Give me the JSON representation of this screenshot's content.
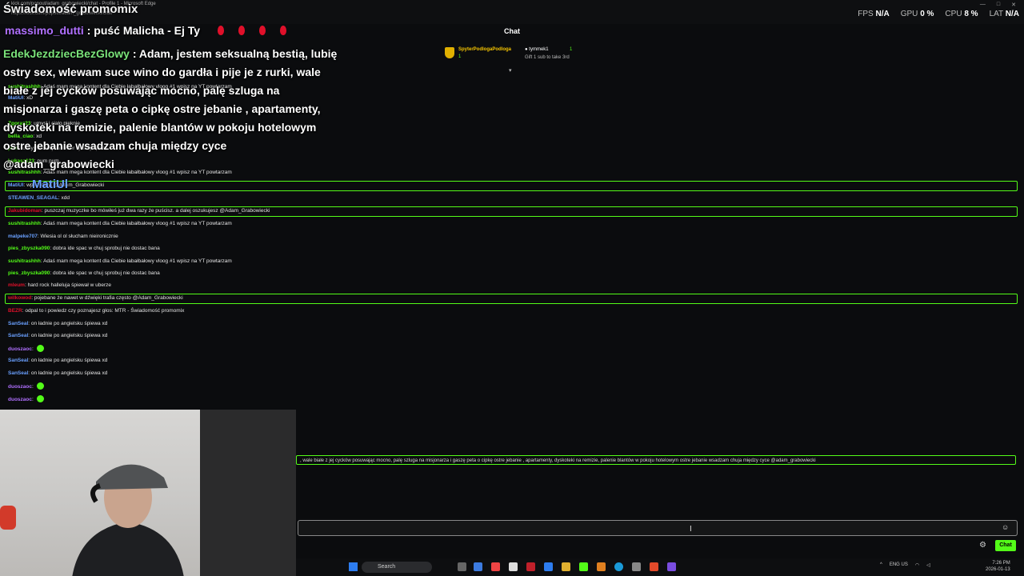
{
  "browser": {
    "title": "kick.com/popout/adam_grabowiecki/chat - Profile 1 - Microsoft Edge",
    "url": "https://kick.com/popout/adam_grabowiecki/chat",
    "controls": [
      "—",
      "□",
      "✕"
    ]
  },
  "stream_title": "Świadomość promomix",
  "perf": [
    {
      "label": "FPS",
      "value": "N/A"
    },
    {
      "label": "GPU",
      "value": "0 %"
    },
    {
      "label": "CPU",
      "value": "8 %"
    },
    {
      "label": "LAT",
      "value": "N/A"
    }
  ],
  "overlay_top": {
    "user": "massimo_dutti",
    "sep": " : ",
    "text": "puść Malicha - Ej Ty"
  },
  "chat_header": "Chat",
  "pinned": {
    "gifter": "SpyterPodlogaPodloga",
    "gifter_count": "1",
    "receiver": "tymmek1",
    "receiver_count": "1",
    "gift_text": "Gift 1 sub to take 3rd"
  },
  "big_message": {
    "user": "EdekJezdziecBezGlowy",
    "sep": " : ",
    "text": "Adam, jestem seksualną bestią, lubię ostry sex, wlewam suce wino do gardła i pije je z rurki, wale białe z jej cycków posuwając mocno, palę szluga na misjonarza i gaszę peta o cipkę ostre jebanie , apartamenty, dyskoteki na remizie, palenie blantów w pokoju hotelowym ostre jebanie wsadzam chuja między cyce @adam_grabowiecki"
  },
  "overlay_user": "MatiUl",
  "chat": {
    "messages": [
      {
        "user": "sushitrashhh",
        "color": "#53fc18",
        "text": "Adaś mam mega kontent dla Ciebie łabałbałowy vloog #1 wpisz na YT powtarzam"
      },
      {
        "user": "MatiUl",
        "color": "#6aa0ff",
        "text": "xD"
      },
      {
        "user": "Zgoraz23",
        "color": "#53fc18",
        "text": "umysł i ciało pięknie"
      },
      {
        "user": "bella_ciao",
        "color": "#53fc18",
        "text": "xd"
      },
      {
        "user": "pwn",
        "color": "#53fc18",
        "text": "to wypierdalaj na rower i jedź pepeW"
      },
      {
        "user": "Lukasz123",
        "color": "#53fc18",
        "text": "pum pum"
      },
      {
        "user": "sushitrashhh",
        "color": "#53fc18",
        "text": "Adaś mam mega kontent dla Ciebie łabałbałowy vloog #1 wpisz na YT powtarzam"
      },
      {
        "user": "MatiUl",
        "color": "#6aa0ff",
        "text": "wpisz na yt @Adam_Grabowiecki"
      },
      {
        "user": "STEAWEN_SEAGAL",
        "color": "#6aa0ff",
        "text": "xdd"
      },
      {
        "user": "Jakubidoman",
        "color": "#e0102a",
        "text": "puszczaj muzyczke bo mówiłeś już dwa razy że puścisz. a dalej oszukujesz @Adam_Grabowiecki"
      },
      {
        "user": "sushitrashhh",
        "color": "#53fc18",
        "text": "Adaś mam mega kontent dla Ciebie łabałbałowy vloog #1 wpisz na YT powtarzam"
      },
      {
        "user": "malpeke707",
        "color": "#6aa0ff",
        "text": "Wiesia ol ol słucham nieironicznie"
      },
      {
        "user": "pies_zbyszka090",
        "color": "#53fc18",
        "text": "dobra ide spac w chuj sprobuj nie dostac bana"
      },
      {
        "user": "sushitrashhh",
        "color": "#53fc18",
        "text": "Adaś mam mega kontent dla Ciebie łabałbałowy vloog #1 wpisz na YT powtarzam"
      },
      {
        "user": "pies_zbyszka090",
        "color": "#53fc18",
        "text": "dobra ide spac w chuj sprobuj nie dostac bana"
      },
      {
        "user": "mleum",
        "color": "#e0102a",
        "text": "hard rock hallelujа śpiewał w uberze"
      },
      {
        "user": "wilkowod",
        "color": "#e0102a",
        "text": "pojebane że nawet w dźwięki trafia często @Adam_Grabowiecki"
      },
      {
        "user": "BEZR",
        "color": "#e0102a",
        "text": "odpal to i powiedz czy poznajesz głos: MTR - Świadomość promomix"
      },
      {
        "user": "SanSeal",
        "color": "#6aa0ff",
        "text": "on ładnie po angielsku śpiewa xd"
      },
      {
        "user": "SanSeal",
        "color": "#6aa0ff",
        "text": "on ładnie po angielsku śpiewa xd"
      },
      {
        "user": "duoszaoc",
        "color": "#b070ff",
        "text": ""
      },
      {
        "user": "SanSeal",
        "color": "#6aa0ff",
        "text": "on ładnie po angielsku śpiewa xd"
      },
      {
        "user": "SanSeal",
        "color": "#6aa0ff",
        "text": "on ładnie po angielsku śpiewa xd"
      },
      {
        "user": "duoszaoc",
        "color": "#b070ff",
        "text": ""
      },
      {
        "user": "duoszaoc",
        "color": "#b070ff",
        "text": ""
      }
    ]
  },
  "echo_message": ", wale białe z jej cycków posuwając mocno, palę szluga na misjonarza i gaszę peta o cipkę ostre jebanie , apartamenty, dyskoteki na remizie, palenie blantów w pokoju hotelowym ostre jebanie wsadzam chuja między cyce @adam_grabowiecki",
  "input": {
    "send_label": "Chat"
  },
  "taskbar": {
    "search_label": "Search",
    "time": "7:26 PM",
    "date": "2026-01-13",
    "lang": "ENG",
    "region": "US"
  },
  "colors": {
    "accent": "#53fc18",
    "background": "#0b0c0e"
  }
}
